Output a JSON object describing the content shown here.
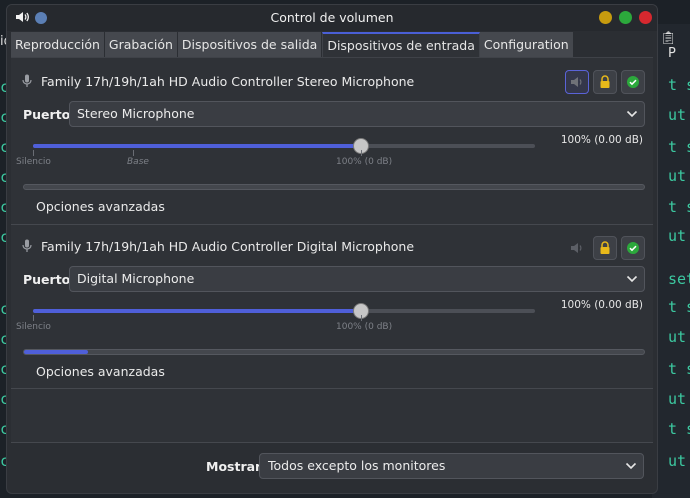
{
  "window": {
    "title": "Control de volumen"
  },
  "tabs": [
    {
      "label": "Reproducción",
      "active": false
    },
    {
      "label": "Grabación",
      "active": false
    },
    {
      "label": "Dispositivos de salida",
      "active": false
    },
    {
      "label": "Dispositivos de entrada",
      "active": true
    },
    {
      "label": "Configuration",
      "active": false
    }
  ],
  "devices": [
    {
      "name": "Family 17h/19h/1ah HD Audio Controller Stereo Microphone",
      "port_label": "Puerto:",
      "port_value": "Stereo Microphone",
      "volume_text": "100% (0.00 dB)",
      "volume_fraction": 1.0,
      "scale_labels": {
        "silence": "Silencio",
        "base": "Base",
        "hundred": "100% (0 dB)"
      },
      "meter_fraction": 0.0,
      "advanced_label": "Opciones avanzadas",
      "muted": true,
      "locked": true,
      "default": true
    },
    {
      "name": "Family 17h/19h/1ah HD Audio Controller Digital Microphone",
      "port_label": "Puerto:",
      "port_value": "Digital Microphone",
      "volume_text": "100% (0.00 dB)",
      "volume_fraction": 1.0,
      "scale_labels": {
        "silence": "Silencio",
        "hundred": "100% (0 dB)"
      },
      "meter_fraction": 0.1,
      "advanced_label": "Opciones avanzadas",
      "muted": false,
      "locked": true,
      "default": true
    }
  ],
  "footer": {
    "show_label": "Mostrar:",
    "show_value": "Todos excepto los monitores"
  },
  "colors": {
    "accent": "#4f5fd9",
    "close": "#d6282f",
    "maximize": "#2ca83c",
    "minimize": "#c79b0f",
    "default_check": "#2ca83c",
    "lock": "#e8b91a"
  },
  "background": {
    "terminal_right_lines": [
      "t siz",
      "ut siz",
      "t siz",
      "ut siz",
      "t siz",
      "ut siz",
      "setti",
      "t siz",
      "ut siz",
      "t siz",
      "ut siz",
      "t siz",
      "ut siz"
    ],
    "terminal_left_char": "ck",
    "clip_letter": "P",
    "left_top": "id"
  }
}
